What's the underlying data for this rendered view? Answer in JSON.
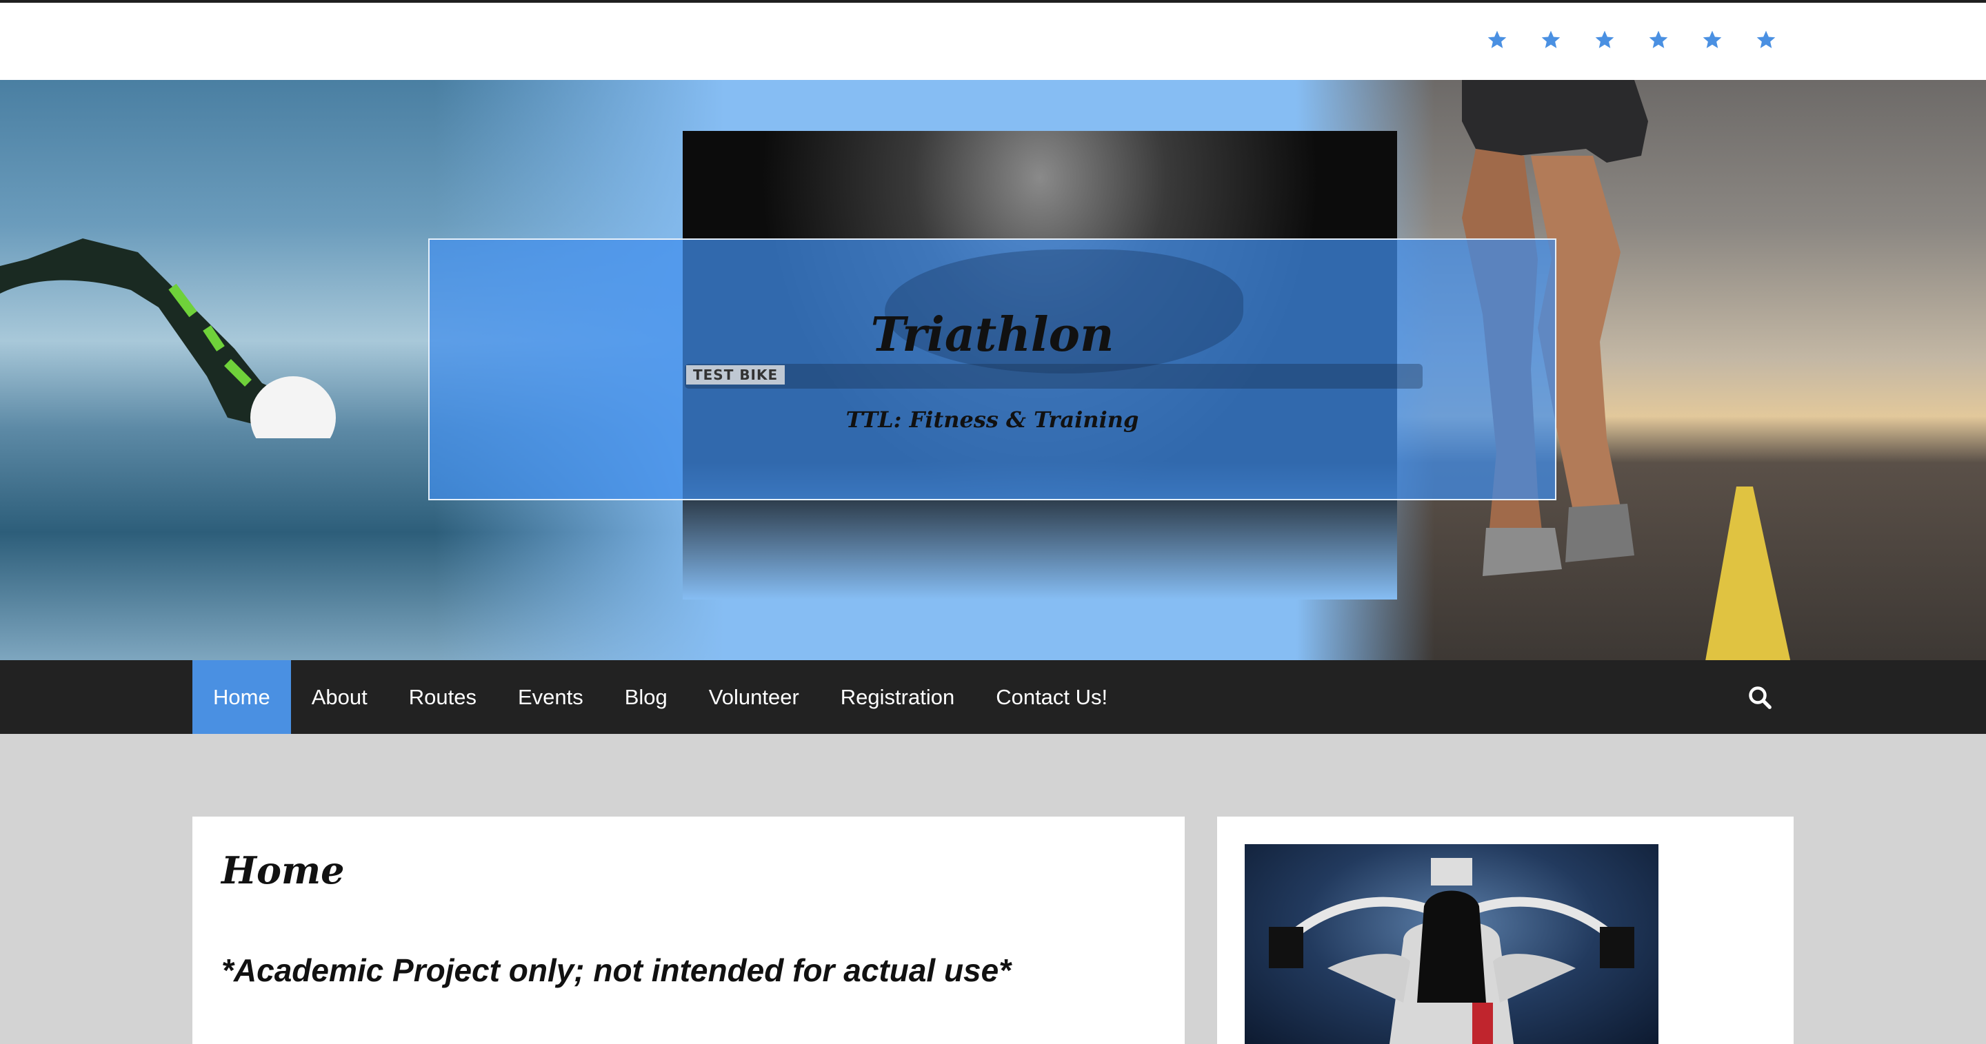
{
  "header": {
    "social_icons": [
      "star-icon",
      "star-icon",
      "star-icon",
      "star-icon",
      "star-icon",
      "star-icon"
    ],
    "accent_color": "#4a90e2"
  },
  "hero": {
    "title": "Triathlon",
    "tagline": "TTL: Fitness & Training",
    "bike_label": "TEST BIKE"
  },
  "nav": {
    "items": [
      {
        "label": "Home",
        "active": true
      },
      {
        "label": "About"
      },
      {
        "label": "Routes"
      },
      {
        "label": "Events"
      },
      {
        "label": "Blog"
      },
      {
        "label": "Volunteer"
      },
      {
        "label": "Registration"
      },
      {
        "label": "Contact Us!"
      }
    ],
    "search_icon": "search-icon"
  },
  "main": {
    "title": "Home",
    "notice": "*Academic Project only; not intended for actual use*"
  }
}
